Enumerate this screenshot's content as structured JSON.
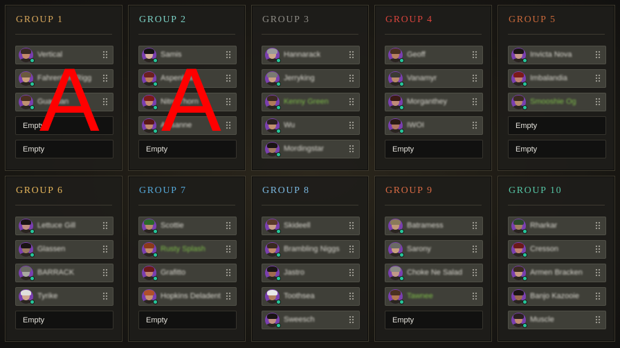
{
  "groups": [
    {
      "title": "GROUP 1",
      "title_color": "#d4a45a",
      "members": [
        {
          "type": "player",
          "name": "Vertical",
          "green": false,
          "skin": "#c48a6a",
          "hair": "#3a2a24"
        },
        {
          "type": "player",
          "name": "Fahrenheit Rigg",
          "green": false,
          "skin": "#c9a07a",
          "hair": "#6b5a3e"
        },
        {
          "type": "player",
          "name": "Guardian",
          "green": false,
          "skin": "#bf9070",
          "hair": "#4a3020"
        },
        {
          "type": "empty",
          "label": "Empty"
        },
        {
          "type": "empty",
          "label": "Empty"
        }
      ]
    },
    {
      "title": "GROUP 2",
      "title_color": "#7ad0c4",
      "members": [
        {
          "type": "player",
          "name": "Samis",
          "green": false,
          "skin": "#d7b29a",
          "hair": "#141212"
        },
        {
          "type": "player",
          "name": "Aspenleaf",
          "green": false,
          "skin": "#b97a5a",
          "hair": "#6a2020"
        },
        {
          "type": "player",
          "name": "Nitro Thorn",
          "green": false,
          "skin": "#c88a70",
          "hair": "#7a1a1a"
        },
        {
          "type": "player",
          "name": "Alysanne",
          "green": false,
          "skin": "#c08a6a",
          "hair": "#5a1818"
        },
        {
          "type": "empty",
          "label": "Empty"
        }
      ]
    },
    {
      "title": "GROUP 3",
      "title_color": "#8d8b85",
      "members": [
        {
          "type": "player",
          "name": "Hannarack",
          "green": false,
          "skin": "#cba88a",
          "hair": "#9a9a9a"
        },
        {
          "type": "player",
          "name": "Jerryking",
          "green": false,
          "skin": "#c8a080",
          "hair": "#7a7a72"
        },
        {
          "type": "player",
          "name": "Kenny Green",
          "green": true,
          "skin": "#b07a5a",
          "hair": "#3a2820"
        },
        {
          "type": "player",
          "name": "Wu",
          "green": false,
          "skin": "#c09070",
          "hair": "#2a2020"
        },
        {
          "type": "player",
          "name": "Mordingstar",
          "green": false,
          "skin": "#a07a60",
          "hair": "#1a1414"
        }
      ]
    },
    {
      "title": "GROUP 4",
      "title_color": "#d8443c",
      "members": [
        {
          "type": "player",
          "name": "Geoff",
          "green": false,
          "skin": "#b88260",
          "hair": "#4a3020"
        },
        {
          "type": "player",
          "name": "Vanamyr",
          "green": false,
          "skin": "#b88a6a",
          "hair": "#3a3a34"
        },
        {
          "type": "player",
          "name": "Morganthey",
          "green": false,
          "skin": "#c08a78",
          "hair": "#3a1a14"
        },
        {
          "type": "player",
          "name": "IWOI",
          "green": false,
          "skin": "#b07860",
          "hair": "#2a1a14"
        },
        {
          "type": "empty",
          "label": "Empty"
        }
      ]
    },
    {
      "title": "GROUP 5",
      "title_color": "#c9683a",
      "members": [
        {
          "type": "player",
          "name": "Invicta Nova",
          "green": false,
          "skin": "#c89a88",
          "hair": "#1a1414"
        },
        {
          "type": "player",
          "name": "Imbalandia",
          "green": false,
          "skin": "#c08070",
          "hair": "#7a1a1a"
        },
        {
          "type": "player",
          "name": "Smooshie Og",
          "green": true,
          "skin": "#b88a6a",
          "hair": "#3a2a20"
        },
        {
          "type": "empty",
          "label": "Empty"
        },
        {
          "type": "empty",
          "label": "Empty"
        }
      ]
    },
    {
      "title": "GROUP 6",
      "title_color": "#e3b45a",
      "members": [
        {
          "type": "player",
          "name": "Lettuce Gill",
          "green": false,
          "skin": "#c09080",
          "hair": "#1a1414"
        },
        {
          "type": "player",
          "name": "Glassen",
          "green": false,
          "skin": "#9a7a60",
          "hair": "#1a1414"
        },
        {
          "type": "player",
          "name": "BARRACK",
          "green": false,
          "skin": "#a8a8a0",
          "hair": "#6a6a64"
        },
        {
          "type": "player",
          "name": "Tyrike",
          "green": false,
          "skin": "#d0a890",
          "hair": "#e0e0dc"
        },
        {
          "type": "empty",
          "label": "Empty"
        }
      ]
    },
    {
      "title": "GROUP 7",
      "title_color": "#55a8d8",
      "members": [
        {
          "type": "player",
          "name": "Scottie",
          "green": false,
          "skin": "#b88a6a",
          "hair": "#2a6a2a"
        },
        {
          "type": "player",
          "name": "Rusty Splash",
          "green": true,
          "skin": "#c08a6a",
          "hair": "#8a3a1a"
        },
        {
          "type": "player",
          "name": "Grafitto",
          "green": false,
          "skin": "#c08070",
          "hair": "#6a1a1a"
        },
        {
          "type": "player",
          "name": "Hopkins Deladent",
          "green": false,
          "skin": "#c89070",
          "hair": "#b0502a"
        },
        {
          "type": "empty",
          "label": "Empty"
        }
      ]
    },
    {
      "title": "GROUP 8",
      "title_color": "#7ab8e0",
      "members": [
        {
          "type": "player",
          "name": "Skideell",
          "green": false,
          "skin": "#c8a08a",
          "hair": "#5a3a2a"
        },
        {
          "type": "player",
          "name": "Brambling Niggs",
          "green": false,
          "skin": "#c08a6a",
          "hair": "#3a2a20"
        },
        {
          "type": "player",
          "name": "Jastro",
          "green": false,
          "skin": "#a06a50",
          "hair": "#1a1414"
        },
        {
          "type": "player",
          "name": "Toothsea",
          "green": false,
          "skin": "#b08060",
          "hair": "#e8e8e8"
        },
        {
          "type": "player",
          "name": "Sweesch",
          "green": false,
          "skin": "#c09080",
          "hair": "#1a1414"
        }
      ]
    },
    {
      "title": "GROUP 9",
      "title_color": "#d86a44",
      "members": [
        {
          "type": "player",
          "name": "Batramess",
          "green": false,
          "skin": "#c09878",
          "hair": "#8a7a5a"
        },
        {
          "type": "player",
          "name": "Sarony",
          "green": false,
          "skin": "#c8a080",
          "hair": "#6a6a64"
        },
        {
          "type": "player",
          "name": "Choke Ne Salad",
          "green": false,
          "skin": "#c09888",
          "hair": "#8a8a84"
        },
        {
          "type": "player",
          "name": "Tawnee",
          "green": true,
          "skin": "#b07850",
          "hair": "#4a3020"
        },
        {
          "type": "empty",
          "label": "Empty"
        }
      ]
    },
    {
      "title": "GROUP 10",
      "title_color": "#55c4a4",
      "members": [
        {
          "type": "player",
          "name": "Rharkar",
          "green": false,
          "skin": "#a08060",
          "hair": "#2a4a2a"
        },
        {
          "type": "player",
          "name": "Cresson",
          "green": false,
          "skin": "#c08070",
          "hair": "#6a1a1a"
        },
        {
          "type": "player",
          "name": "Armen Bracken",
          "green": false,
          "skin": "#c89a80",
          "hair": "#3a2a20"
        },
        {
          "type": "player",
          "name": "Banjo Kazooie",
          "green": false,
          "skin": "#9a6a50",
          "hair": "#1a1414"
        },
        {
          "type": "player",
          "name": "Muscle",
          "green": false,
          "skin": "#c08a70",
          "hair": "#2a2020"
        }
      ]
    }
  ],
  "overlay": {
    "letter1": "A",
    "letter2": "A"
  }
}
